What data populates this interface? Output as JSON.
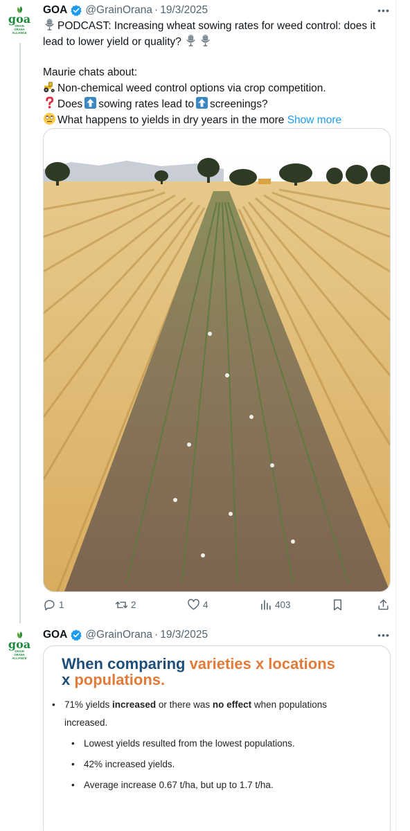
{
  "tweet1": {
    "author": {
      "name": "GOA",
      "handle": "@GrainOrana",
      "date": "19/3/2025"
    },
    "lines": [
      "PODCAST: Increasing wheat sowing rates for weed control: does it",
      "lead to lower yield or quality?",
      "Maurie chats about:",
      "Non-chemical weed control options via crop competition.",
      "Does",
      "sowing rates lead to",
      "screenings?",
      "What happens to yields in dry years in the more"
    ],
    "show_more": "Show more",
    "image_alt": "Wheat stubble field with a weedy unsown strip running down the centre, trees and a harvester on the horizon",
    "stats": {
      "replies": "1",
      "reposts": "2",
      "likes": "4",
      "views": "403"
    }
  },
  "tweet2": {
    "author": {
      "name": "GOA",
      "handle": "@GrainOrana",
      "date": "19/3/2025"
    },
    "card": {
      "title_blue": "When comparing ",
      "title_orange": "varieties x locations",
      "title_line2_blue": "x  ",
      "title_line2_orange": "populations.",
      "bullet_main_a": "71% yields ",
      "bullet_main_b": "increased",
      "bullet_main_c": " or there was ",
      "bullet_main_d": "no effect",
      "bullet_main_e": " when populations",
      "bullet_main_f": "increased.",
      "sub_bullets": [
        "Lowest yields resulted from the lowest populations.",
        "42% increased yields.",
        "Average increase 0.67 t/ha, but up to 1.7 t/ha."
      ]
    }
  },
  "logo": {
    "word": "goa",
    "lines": [
      "GRAIN",
      "ORANA",
      "ALLIANCE"
    ]
  },
  "colors": {
    "accent": "#1d9bf0",
    "muted": "#536471",
    "logo_green": "#1d8a3c",
    "card_blue": "#1f4e79",
    "card_orange": "#e07b39"
  }
}
